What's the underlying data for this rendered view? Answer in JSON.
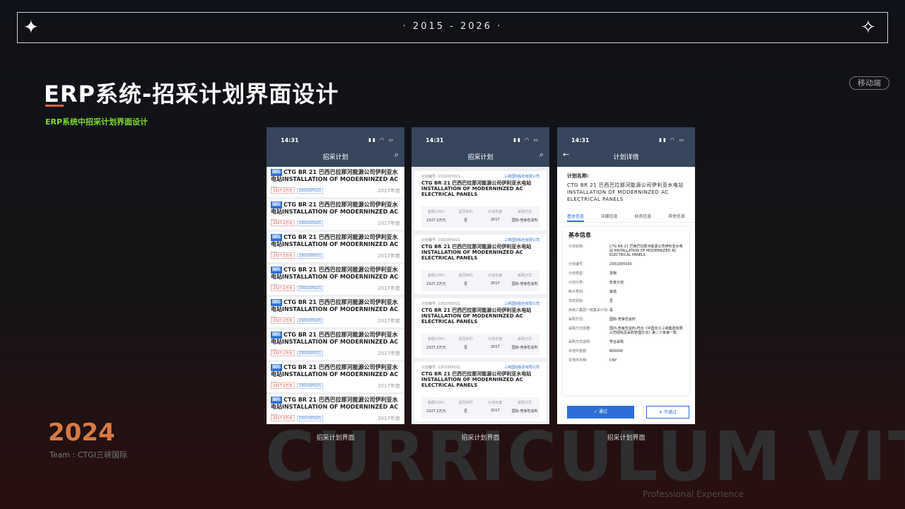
{
  "header": {
    "years": "· 2015 - 2026 ·"
  },
  "title": "ERP系统-招采计划界面设计",
  "subtitle": "ERP系统中招采计划界面设计",
  "badge": "移动端",
  "footer": {
    "year": "2024",
    "team": "Team : CTGI三峡国际",
    "bigtext": "CURRICULUM VIT",
    "prof": "Professional Experience"
  },
  "colors": {
    "accent": "#e2622d",
    "green": "#7ddc2a",
    "nav": "#37465c",
    "blue": "#2d6fd6"
  },
  "phone1": {
    "time": "14:31",
    "title": "招采计划",
    "caption": "招采计划界面",
    "items": [
      {
        "tag": "国际",
        "name": "CTG BR 21 巴西巴拉那河能源公司伊利亚水电站INSTALLATION OF MODERNINZED AC ...",
        "amount": "2327.2万元",
        "code": "2301005021",
        "year": "2017年度"
      },
      {
        "tag": "国际",
        "name": "CTG BR 21 巴西巴拉那河能源公司伊利亚水电站INSTALLATION OF MODERNINZED AC ...",
        "amount": "2327.2万元",
        "code": "2301005021",
        "year": "2017年度"
      },
      {
        "tag": "国际",
        "name": "CTG BR 21 巴西巴拉那河能源公司伊利亚水电站INSTALLATION OF MODERNINZED AC ...",
        "amount": "2327.2万元",
        "code": "2301005021",
        "year": "2017年度"
      },
      {
        "tag": "国际",
        "name": "CTG BR 21 巴西巴拉那河能源公司伊利亚水电站INSTALLATION OF MODERNINZED AC ...",
        "amount": "2327.2万元",
        "code": "2301005021",
        "year": "2017年度"
      },
      {
        "tag": "国际",
        "name": "CTG BR 21 巴西巴拉那河能源公司伊利亚水电站INSTALLATION OF MODERNINZED AC ...",
        "amount": "2327.2万元",
        "code": "2301005021",
        "year": "2017年度"
      },
      {
        "tag": "国际",
        "name": "CTG BR 21 巴西巴拉那河能源公司伊利亚水电站INSTALLATION OF MODERNINZED AC ...",
        "amount": "2327.2万元",
        "code": "2301005021",
        "year": "2017年度"
      },
      {
        "tag": "国际",
        "name": "CTG BR 21 巴西巴拉那河能源公司伊利亚水电站INSTALLATION OF MODERNINZED AC ...",
        "amount": "2327.2万元",
        "code": "2301005021",
        "year": "2017年度"
      },
      {
        "tag": "国际",
        "name": "CTG BR 21 巴西巴拉那河能源公司伊利亚水电站INSTALLATION OF MODERNINZED AC ...",
        "amount": "2327.2万元",
        "code": "2301005021",
        "year": "2017年度"
      }
    ]
  },
  "phone2": {
    "time": "14:31",
    "title": "招采计划",
    "caption": "招采计划界面",
    "labels": [
      "金额(CNY)",
      "是否转列",
      "计划年度",
      "采购方式"
    ],
    "cards": [
      {
        "no": "计划编号: 2301005021",
        "company": "三峡国际股份有限公司",
        "name": "CTG BR 21 巴西巴拉那河能源公司伊利亚水电站INSTALLATION OF MODERNINZED AC ELECTRICAL PANELS",
        "values": [
          "2327.2万元",
          "否",
          "2017",
          "国际-竞争性谈判"
        ]
      },
      {
        "no": "计划编号: 2301005021",
        "company": "三峡国际股份有限公司",
        "name": "CTG BR 21 巴西巴拉那河能源公司伊利亚水电站INSTALLATION OF MODERNINZED AC ELECTRICAL PANELS",
        "values": [
          "2327.2万元",
          "否",
          "2017",
          "国际-竞争性谈判"
        ]
      },
      {
        "no": "计划编号: 2301005021",
        "company": "三峡国际股份有限公司",
        "name": "CTG BR 21 巴西巴拉那河能源公司伊利亚水电站INSTALLATION OF MODERNINZED AC ELECTRICAL PANELS",
        "values": [
          "2327.2万元",
          "否",
          "2017",
          "国际-竞争性谈判"
        ]
      },
      {
        "no": "计划编号: 2301005021",
        "company": "三峡国际股份有限公司",
        "name": "CTG BR 21 巴西巴拉那河能源公司伊利亚水电站INSTALLATION OF MODERNINZED AC ELECTRICAL PANELS",
        "values": [
          "2327.2万元",
          "否",
          "2017",
          "国际-竞争性谈判"
        ]
      }
    ]
  },
  "phone3": {
    "time": "14:31",
    "title": "计划详情",
    "caption": "招采计划界面",
    "plan_label": "计划名称:",
    "plan_value": "CTG BR 21 巴西巴拉那河能源公司伊利亚水电站 INSTALLATION OF MODERNINZED AC ELECTRICAL PANELS",
    "tabs": [
      "基本信息",
      "详细信息",
      "财务信息",
      "其他信息"
    ],
    "section": "基本信息",
    "fields": [
      {
        "k": "计划名称:",
        "v": "CTG BR 21 巴西巴拉那河能源公司伊利亚水电站 INSTALLATION OF MODERNIZED AC ELECTRICAL PANELS"
      },
      {
        "k": "计划编号:",
        "v": "2301005030"
      },
      {
        "k": "计划类型:",
        "v": "货物"
      },
      {
        "k": "计划分类:",
        "v": "年度计划"
      },
      {
        "k": "统计类别:",
        "v": "其他"
      },
      {
        "k": "法定招标:",
        "v": "否"
      },
      {
        "k": "拟纳入集团一级集采计划:",
        "v": "是"
      },
      {
        "k": "采购方式:",
        "v": "国际-竞争性谈判"
      },
      {
        "k": "采购方式依据:",
        "v": "国内-竞争性谈判-符合《中国长江三峡集团有限公司招标及采购管理办法》第二十条第一款"
      },
      {
        "k": "采购方式说明:",
        "v": "符合采购"
      },
      {
        "k": "本地币金额:",
        "v": "800000"
      },
      {
        "k": "本地币币种:",
        "v": "CNY"
      }
    ],
    "approve": "✓ 通过",
    "reject": "✕ 不通过"
  }
}
